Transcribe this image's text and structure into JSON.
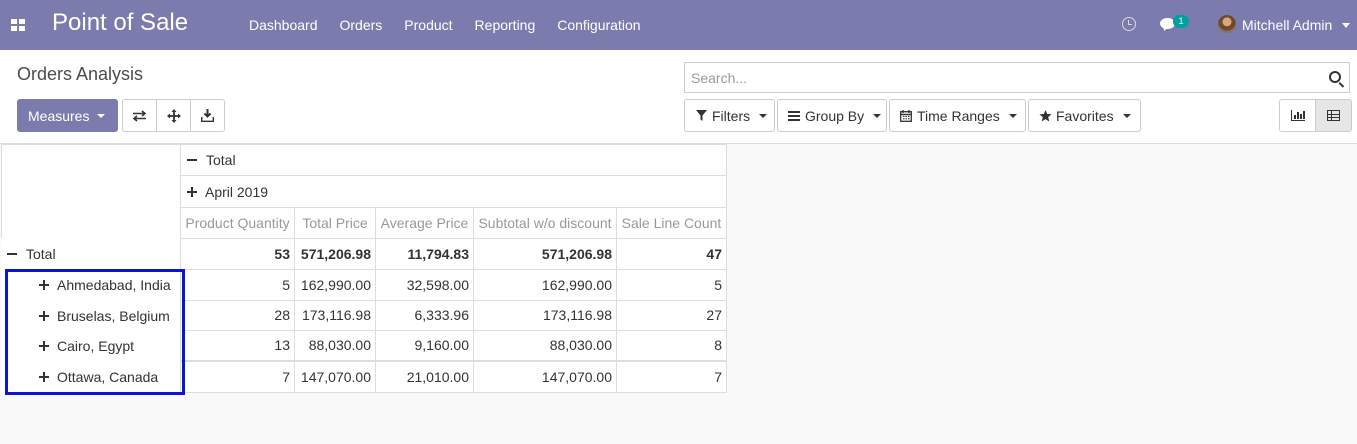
{
  "app": {
    "title": "Point of Sale"
  },
  "nav": {
    "menu": [
      "Dashboard",
      "Orders",
      "Product",
      "Reporting",
      "Configuration"
    ],
    "chat_badge": "1",
    "user": "Mitchell Admin"
  },
  "page": {
    "title": "Orders Analysis"
  },
  "search": {
    "placeholder": "Search..."
  },
  "toolbar": {
    "measures_label": "Measures",
    "filters_label": "Filters",
    "group_by_label": "Group By",
    "time_ranges_label": "Time Ranges",
    "favorites_label": "Favorites"
  },
  "pivot": {
    "col_total_label": "Total",
    "col_group_label": "April 2019",
    "measures": [
      "Product Quantity",
      "Total Price",
      "Average Price",
      "Subtotal w/o discount",
      "Sale Line Count"
    ],
    "row_total_label": "Total",
    "total_values": [
      "53",
      "571,206.98",
      "11,794.83",
      "571,206.98",
      "47"
    ],
    "rows": [
      {
        "label": "Ahmedabad, India",
        "values": [
          "5",
          "162,990.00",
          "32,598.00",
          "162,990.00",
          "5"
        ]
      },
      {
        "label": "Bruselas, Belgium",
        "values": [
          "28",
          "173,116.98",
          "6,333.96",
          "173,116.98",
          "27"
        ]
      },
      {
        "label": "Cairo, Egypt",
        "values": [
          "13",
          "88,030.00",
          "9,160.00",
          "88,030.00",
          "8"
        ]
      },
      {
        "label": "Ottawa, Canada",
        "values": [
          "7",
          "147,070.00",
          "21,010.00",
          "147,070.00",
          "7"
        ]
      }
    ]
  },
  "colors": {
    "navbar": "#7c7bad",
    "highlight_border": "#0a14d6",
    "badge": "#00a09d"
  }
}
